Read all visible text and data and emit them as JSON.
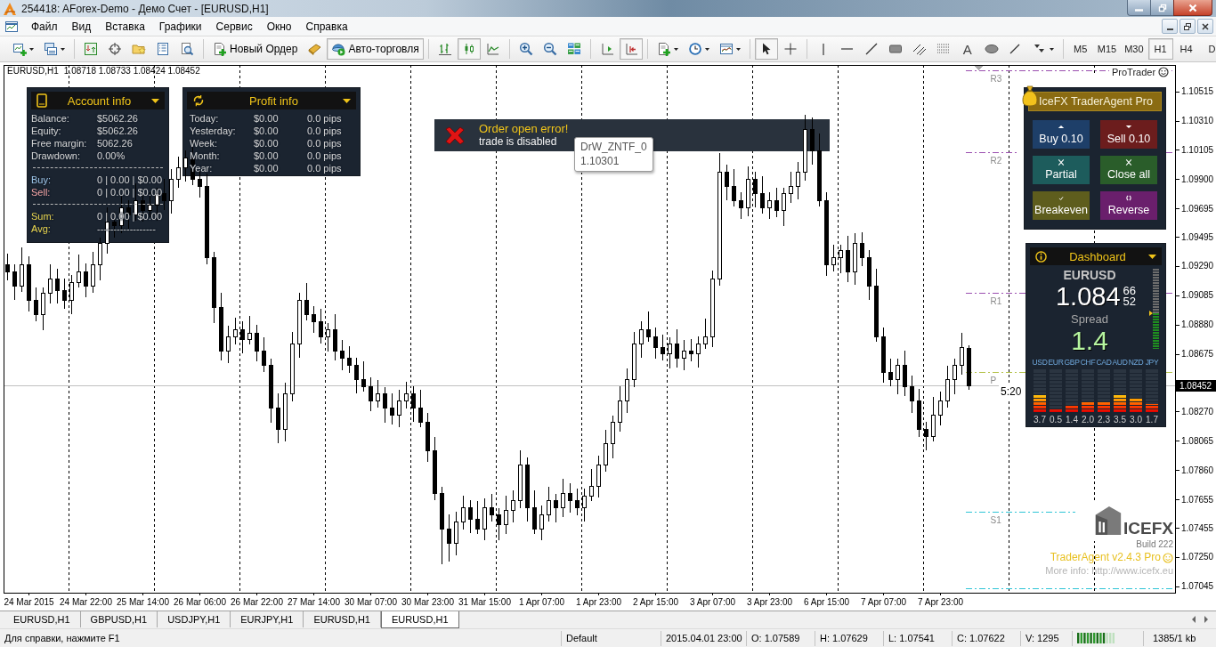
{
  "window": {
    "title": "254418: AForex-Demo - Демо Счет - [EURUSD,H1]"
  },
  "menu": [
    "Файл",
    "Вид",
    "Вставка",
    "Графики",
    "Сервис",
    "Окно",
    "Справка"
  ],
  "toolbar": {
    "groups": [
      [
        {
          "kind": "new-chart",
          "pressed": false
        },
        {
          "kind": "profiles",
          "pressed": false
        }
      ],
      [
        {
          "kind": "market-watch",
          "pressed": false
        },
        {
          "kind": "data-window",
          "pressed": false
        },
        {
          "kind": "navigator",
          "pressed": false
        },
        {
          "kind": "terminal",
          "pressed": false
        },
        {
          "kind": "tester",
          "pressed": false
        }
      ],
      [
        {
          "kind": "new-order",
          "label": "Новый Ордер",
          "pressed": false
        },
        {
          "kind": "editor",
          "pressed": false
        },
        {
          "kind": "autotrade",
          "label": "Авто-торговля",
          "pressed": true
        }
      ],
      [
        {
          "kind": "bar-chart",
          "pressed": false
        },
        {
          "kind": "candles",
          "pressed": true
        },
        {
          "kind": "line-chart",
          "pressed": false
        }
      ],
      [
        {
          "kind": "zoom-in",
          "pressed": false
        },
        {
          "kind": "zoom-out",
          "pressed": false
        },
        {
          "kind": "tile",
          "pressed": false
        }
      ],
      [
        {
          "kind": "chart-shift",
          "pressed": false
        },
        {
          "kind": "autoscroll",
          "pressed": true
        }
      ],
      [
        {
          "kind": "indicators",
          "pressed": false
        },
        {
          "kind": "periods",
          "pressed": false
        },
        {
          "kind": "templates",
          "pressed": false
        }
      ],
      [
        {
          "kind": "cursor",
          "pressed": true
        },
        {
          "kind": "crosshair",
          "pressed": false
        }
      ],
      [
        {
          "kind": "vline",
          "pressed": false
        },
        {
          "kind": "hline",
          "pressed": false
        },
        {
          "kind": "trendline",
          "pressed": false
        },
        {
          "kind": "rectangle",
          "pressed": false
        },
        {
          "kind": "channel",
          "pressed": false
        },
        {
          "kind": "fibo",
          "pressed": false
        },
        {
          "kind": "text",
          "label": "A",
          "pressed": false
        },
        {
          "kind": "ellipse",
          "pressed": false
        },
        {
          "kind": "gann",
          "pressed": false
        },
        {
          "kind": "arrows",
          "pressed": false
        }
      ]
    ],
    "timeframes": [
      {
        "label": "M5",
        "selected": false
      },
      {
        "label": "M15",
        "selected": false
      },
      {
        "label": "M30",
        "selected": false
      },
      {
        "label": "H1",
        "selected": true
      },
      {
        "label": "H4",
        "selected": false
      },
      {
        "label": "D",
        "selected": false
      }
    ]
  },
  "chart": {
    "symbol": "EURUSD,H1",
    "quote": "1.08718 1.08733 1.08424 1.08452",
    "indicator_label": "ProTrader",
    "timer": "5:20",
    "chart_data": {
      "type": "candlestick",
      "categories": [
        null,
        null,
        null,
        "24 Mar 2015",
        null,
        null,
        null,
        null,
        null,
        null,
        null,
        "24 Mar 22:00",
        null,
        null,
        null,
        null,
        null,
        null,
        null,
        "25 Mar 14:00",
        null,
        null,
        null,
        null,
        null,
        null,
        null,
        "26 Mar 06:00",
        null,
        null,
        null,
        null,
        null,
        null,
        null,
        "26 Mar 22:00",
        null,
        null,
        null,
        null,
        null,
        null,
        null,
        "27 Mar 14:00",
        null,
        null,
        null,
        null,
        null,
        null,
        null,
        "30 Mar 07:00",
        null,
        null,
        null,
        null,
        null,
        null,
        null,
        "30 Mar 23:00",
        null,
        null,
        null,
        null,
        null,
        null,
        null,
        "31 Mar 15:00",
        null,
        null,
        null,
        null,
        null,
        null,
        null,
        "1 Apr 07:00",
        null,
        null,
        null,
        null,
        null,
        null,
        null,
        "1 Apr 23:00",
        null,
        null,
        null,
        null,
        null,
        null,
        null,
        "2 Apr 15:00",
        null,
        null,
        null,
        null,
        null,
        null,
        null,
        "3 Apr 07:00",
        null,
        null,
        null,
        null,
        null,
        null,
        null,
        "3 Apr 23:00",
        null,
        null,
        null,
        null,
        null,
        null,
        null,
        "6 Apr 15:00",
        null,
        null,
        null,
        null,
        null,
        null,
        null,
        "7 Apr 07:00",
        null,
        null,
        null,
        null,
        null,
        null,
        null,
        "7 Apr 23:00",
        null,
        null,
        null,
        null,
        null,
        null,
        null,
        null,
        null,
        null,
        null,
        null,
        null,
        null,
        null,
        null,
        null,
        null,
        null,
        null,
        null,
        null,
        null,
        null,
        null,
        null,
        null,
        null,
        null,
        null,
        null,
        null
      ],
      "ohlc": [
        [
          1.093,
          1.0938,
          1.0919,
          1.0925
        ],
        [
          1.0925,
          1.093,
          1.0905,
          1.0915
        ],
        [
          1.0915,
          1.0942,
          1.0911,
          1.093
        ],
        [
          1.093,
          1.0936,
          1.0897,
          1.0905
        ],
        [
          1.0905,
          1.0914,
          1.089,
          1.0895
        ],
        [
          1.0895,
          1.0914,
          1.0884,
          1.091
        ],
        [
          1.091,
          1.093,
          1.0903,
          1.092
        ],
        [
          1.092,
          1.0927,
          1.0903,
          1.0912
        ],
        [
          1.0912,
          1.092,
          1.0899,
          1.0905
        ],
        [
          1.0905,
          1.0923,
          1.0895,
          1.0918
        ],
        [
          1.0918,
          1.0937,
          1.0914,
          1.0925
        ],
        [
          1.0925,
          1.0931,
          1.0907,
          1.0915
        ],
        [
          1.0915,
          1.0939,
          1.091,
          1.093
        ],
        [
          1.093,
          1.0949,
          1.0919,
          1.0945
        ],
        [
          1.0945,
          1.097,
          1.0938,
          1.096
        ],
        [
          1.096,
          1.0967,
          1.0949,
          1.0958
        ],
        [
          1.0958,
          1.0978,
          1.0952,
          1.097
        ],
        [
          1.097,
          1.0975,
          1.0955,
          1.0965
        ],
        [
          1.0965,
          1.0987,
          1.0961,
          1.0975
        ],
        [
          1.0975,
          1.0981,
          1.096,
          1.0968
        ],
        [
          1.0968,
          1.0981,
          1.0963,
          1.0972
        ],
        [
          1.0972,
          1.0984,
          1.0961,
          1.098
        ],
        [
          1.098,
          1.099,
          1.0968,
          1.0975
        ],
        [
          1.0975,
          1.0997,
          1.0966,
          1.099
        ],
        [
          1.099,
          1.1006,
          1.0984,
          1.0998
        ],
        [
          1.0998,
          1.101,
          1.0988,
          1.1005
        ],
        [
          1.1005,
          1.1017,
          1.0986,
          1.099
        ],
        [
          1.099,
          1.0996,
          1.0977,
          1.0985
        ],
        [
          1.0985,
          1.0994,
          1.093,
          1.0935
        ],
        [
          1.0935,
          1.0939,
          1.0889,
          1.09
        ],
        [
          1.09,
          1.091,
          1.0863,
          1.087
        ],
        [
          1.087,
          1.0887,
          1.0861,
          1.088
        ],
        [
          1.088,
          1.0893,
          1.0874,
          1.0885
        ],
        [
          1.0885,
          1.089,
          1.0868,
          1.0878
        ],
        [
          1.0878,
          1.0894,
          1.0874,
          1.0882
        ],
        [
          1.0882,
          1.0888,
          1.0862,
          1.087
        ],
        [
          1.087,
          1.0879,
          1.0855,
          1.086
        ],
        [
          1.086,
          1.0864,
          1.0819,
          1.083
        ],
        [
          1.083,
          1.084,
          1.0805,
          1.0815
        ],
        [
          1.0815,
          1.0847,
          1.0806,
          1.084
        ],
        [
          1.084,
          1.0883,
          1.0834,
          1.0875
        ],
        [
          1.0875,
          1.091,
          1.0865,
          1.0905
        ],
        [
          1.0905,
          1.0917,
          1.0891,
          1.0895
        ],
        [
          1.0895,
          1.0901,
          1.0882,
          1.089
        ],
        [
          1.089,
          1.0899,
          1.0875,
          1.088
        ],
        [
          1.088,
          1.0889,
          1.0869,
          1.0885
        ],
        [
          1.0885,
          1.0895,
          1.0863,
          1.087
        ],
        [
          1.087,
          1.0877,
          1.0856,
          1.0865
        ],
        [
          1.0865,
          1.0873,
          1.0854,
          1.086
        ],
        [
          1.086,
          1.0865,
          1.084,
          1.085
        ],
        [
          1.085,
          1.0862,
          1.0841,
          1.0845
        ],
        [
          1.0845,
          1.0851,
          1.0827,
          1.0835
        ],
        [
          1.0835,
          1.0849,
          1.083,
          1.084
        ],
        [
          1.084,
          1.0844,
          1.0819,
          1.083
        ],
        [
          1.083,
          1.084,
          1.0818,
          1.0825
        ],
        [
          1.0825,
          1.0842,
          1.0816,
          1.0835
        ],
        [
          1.0835,
          1.0848,
          1.0829,
          1.084
        ],
        [
          1.084,
          1.0845,
          1.082,
          1.083
        ],
        [
          1.083,
          1.0842,
          1.0816,
          1.082
        ],
        [
          1.082,
          1.0826,
          1.0792,
          1.08
        ],
        [
          1.08,
          1.0809,
          1.0765,
          1.077
        ],
        [
          1.077,
          1.0774,
          1.072,
          1.0745
        ],
        [
          1.0745,
          1.0755,
          1.0722,
          1.0735
        ],
        [
          1.0735,
          1.0757,
          1.0726,
          1.075
        ],
        [
          1.075,
          1.0768,
          1.0744,
          1.076
        ],
        [
          1.076,
          1.0765,
          1.0742,
          1.0752
        ],
        [
          1.0752,
          1.0764,
          1.0741,
          1.0745
        ],
        [
          1.0745,
          1.0766,
          1.0737,
          1.076
        ],
        [
          1.076,
          1.0769,
          1.075,
          1.0755
        ],
        [
          1.0755,
          1.0759,
          1.0737,
          1.0748
        ],
        [
          1.0748,
          1.0768,
          1.0741,
          1.0758
        ],
        [
          1.0758,
          1.0772,
          1.0749,
          1.0765
        ],
        [
          1.0765,
          1.08,
          1.0759,
          1.079
        ],
        [
          1.079,
          1.0795,
          1.075,
          1.076
        ],
        [
          1.076,
          1.0772,
          1.0741,
          1.0745
        ],
        [
          1.0745,
          1.0761,
          1.0737,
          1.0755
        ],
        [
          1.0755,
          1.0774,
          1.075,
          1.0765
        ],
        [
          1.0765,
          1.0769,
          1.0749,
          1.076
        ],
        [
          1.076,
          1.078,
          1.0753,
          1.077
        ],
        [
          1.077,
          1.0777,
          1.0756,
          1.0765
        ],
        [
          1.0765,
          1.0773,
          1.0754,
          1.076
        ],
        [
          1.076,
          1.0773,
          1.075,
          1.0768
        ],
        [
          1.0768,
          1.0787,
          1.0764,
          1.0775
        ],
        [
          1.0775,
          1.0796,
          1.0767,
          1.079
        ],
        [
          1.079,
          1.0814,
          1.0785,
          1.0805
        ],
        [
          1.0805,
          1.0824,
          1.0794,
          1.082
        ],
        [
          1.082,
          1.0845,
          1.0813,
          1.0835
        ],
        [
          1.0835,
          1.0857,
          1.0826,
          1.085
        ],
        [
          1.085,
          1.0883,
          1.0844,
          1.0875
        ],
        [
          1.0875,
          1.089,
          1.0865,
          1.0885
        ],
        [
          1.0885,
          1.0897,
          1.0876,
          1.088
        ],
        [
          1.088,
          1.0886,
          1.0864,
          1.0872
        ],
        [
          1.0872,
          1.0881,
          1.0863,
          1.0868
        ],
        [
          1.0868,
          1.0879,
          1.0857,
          1.0875
        ],
        [
          1.0875,
          1.0885,
          1.0858,
          1.0865
        ],
        [
          1.0865,
          1.0877,
          1.0856,
          1.087
        ],
        [
          1.087,
          1.0878,
          1.0862,
          1.0868
        ],
        [
          1.0868,
          1.088,
          1.0858,
          1.0875
        ],
        [
          1.0875,
          1.0892,
          1.0871,
          1.088
        ],
        [
          1.088,
          1.0926,
          1.0872,
          1.092
        ],
        [
          1.092,
          1.1008,
          1.0915,
          1.0995
        ],
        [
          1.0995,
          1.1,
          1.0975,
          1.0985
        ],
        [
          1.0985,
          1.0997,
          1.0971,
          1.0975
        ],
        [
          1.0975,
          1.0981,
          1.0962,
          1.097
        ],
        [
          1.097,
          1.0999,
          1.0964,
          1.099
        ],
        [
          1.099,
          1.0995,
          1.097,
          1.098
        ],
        [
          1.098,
          1.0992,
          1.0966,
          1.097
        ],
        [
          1.097,
          1.0981,
          1.0962,
          1.0975
        ],
        [
          1.0975,
          1.0984,
          1.0963,
          1.0968
        ],
        [
          1.0968,
          1.0984,
          1.0957,
          1.098
        ],
        [
          1.098,
          1.0995,
          1.0973,
          1.0985
        ],
        [
          1.0985,
          1.1002,
          1.0976,
          1.0995
        ],
        [
          1.0995,
          1.1035,
          1.0989,
          1.1025
        ],
        [
          1.1025,
          1.1033,
          1.1,
          1.101
        ],
        [
          1.101,
          1.1022,
          1.0971,
          1.0975
        ],
        [
          1.0975,
          1.0981,
          1.0922,
          1.093
        ],
        [
          1.093,
          1.0944,
          1.0925,
          1.0935
        ],
        [
          1.0935,
          1.0944,
          1.0924,
          1.094
        ],
        [
          1.094,
          1.095,
          1.0918,
          1.0925
        ],
        [
          1.0925,
          1.0952,
          1.0916,
          1.0945
        ],
        [
          1.0945,
          1.0953,
          1.0929,
          1.0935
        ],
        [
          1.0935,
          1.094,
          1.0905,
          1.0915
        ],
        [
          1.0915,
          1.0927,
          1.0876,
          1.088
        ],
        [
          1.088,
          1.0886,
          1.0847,
          1.0855
        ],
        [
          1.0855,
          1.0864,
          1.0845,
          1.085
        ],
        [
          1.085,
          1.0864,
          1.0839,
          1.086
        ],
        [
          1.086,
          1.087,
          1.0838,
          1.0845
        ],
        [
          1.0845,
          1.0852,
          1.0826,
          1.0835
        ],
        [
          1.0835,
          1.0843,
          1.0809,
          1.0815
        ],
        [
          1.0815,
          1.082,
          1.08,
          1.081
        ],
        [
          1.081,
          1.0837,
          1.0806,
          1.0825
        ],
        [
          1.0825,
          1.0841,
          1.0817,
          1.0835
        ],
        [
          1.0835,
          1.0859,
          1.083,
          1.085
        ],
        [
          1.085,
          1.0864,
          1.0839,
          1.086
        ],
        [
          1.086,
          1.0882,
          1.0853,
          1.0872
        ],
        [
          1.08718,
          1.08733,
          1.08424,
          1.08452
        ],
        null,
        null,
        null,
        null,
        null,
        null,
        null,
        null,
        null,
        null,
        null,
        null,
        null,
        null,
        null,
        null,
        null,
        null,
        null,
        null,
        null,
        null,
        null,
        null,
        null,
        null,
        null,
        null
      ],
      "ylim": [
        1.07,
        1.107
      ],
      "yticks": [
        {
          "value": 1.10515,
          "label": "1.10515"
        },
        {
          "value": 1.1031,
          "label": "1.10310"
        },
        {
          "value": 1.10105,
          "label": "1.10105"
        },
        {
          "value": 1.099,
          "label": "1.09900"
        },
        {
          "value": 1.09695,
          "label": "1.09695"
        },
        {
          "value": 1.09495,
          "label": "1.09495"
        },
        {
          "value": 1.0929,
          "label": "1.09290"
        },
        {
          "value": 1.09085,
          "label": "1.09085"
        },
        {
          "value": 1.0888,
          "label": "1.08880"
        },
        {
          "value": 1.08675,
          "label": "1.08675"
        },
        {
          "value": 1.0827,
          "label": "1.08270"
        },
        {
          "value": 1.08065,
          "label": "1.08065"
        },
        {
          "value": 1.0786,
          "label": "1.07860"
        },
        {
          "value": 1.07655,
          "label": "1.07655"
        },
        {
          "value": 1.07455,
          "label": "1.07455"
        },
        {
          "value": 1.0725,
          "label": "1.07250"
        },
        {
          "value": 1.07045,
          "label": "1.07045"
        }
      ],
      "ref_lines": [
        {
          "axis": "y",
          "value": 1.1066,
          "label": "R3",
          "color": "#9b4fb0",
          "line_style": "dashdot"
        },
        {
          "axis": "y",
          "value": 1.1009,
          "label": "R2",
          "color": "#9b4fb0",
          "line_style": "dashdot"
        },
        {
          "axis": "y",
          "value": 1.091,
          "label": "R1",
          "color": "#9b4fb0",
          "line_style": "dashdot"
        },
        {
          "axis": "y",
          "value": 1.0855,
          "label": "P",
          "color": "#b5c24a",
          "line_style": "dashdot"
        },
        {
          "axis": "y",
          "value": 1.0757,
          "label": "S1",
          "color": "#2ec4d6",
          "line_style": "dashdot"
        },
        {
          "axis": "y",
          "value": 1.0703,
          "color": "#2ec4d6",
          "line_style": "dashdot"
        },
        {
          "axis": "y",
          "value": 1.08452,
          "label": "1.08452",
          "color": "#c0c0c0",
          "line_style": "solid"
        }
      ],
      "grid": true
    }
  },
  "account_panel": {
    "title": "Account info",
    "sections": [
      [
        {
          "label": "Balance:",
          "value": "$5062.26",
          "color": "#d4d4d4"
        },
        {
          "label": "Equity:",
          "value": "$5062.26",
          "color": "#d4d4d4"
        },
        {
          "label": "Free margin:",
          "value": "5062.26",
          "color": "#d4d4d4"
        },
        {
          "label": "Drawdown:",
          "value": "0.00%",
          "color": "#d4d4d4"
        }
      ],
      [
        {
          "label": "Buy:",
          "value": "0 | 0.00 | $0.00",
          "color": "#9cc3e6"
        },
        {
          "label": "Sell:",
          "value": "0 | 0.00 | $0.00",
          "color": "#f2a3a3"
        }
      ],
      [
        {
          "label": "Sum:",
          "value": "0 | 0.00 | $0.00",
          "color": "#e8d44d"
        },
        {
          "label": "Avg:",
          "value": "------------------",
          "color": "#e8d44d"
        }
      ]
    ]
  },
  "profit_panel": {
    "title": "Profit info",
    "rows": [
      {
        "label": "Today:",
        "amount": "$0.00",
        "pips": "0.0 pips"
      },
      {
        "label": "Yesterday:",
        "amount": "$0.00",
        "pips": "0.0 pips"
      },
      {
        "label": "Week:",
        "amount": "$0.00",
        "pips": "0.0 pips"
      },
      {
        "label": "Month:",
        "amount": "$0.00",
        "pips": "0.0 pips"
      },
      {
        "label": "Year:",
        "amount": "$0.00",
        "pips": "0.0 pips"
      }
    ]
  },
  "alert": {
    "title": "Order open error!",
    "message": "trade is disabled"
  },
  "tooltip": {
    "title": "DrW_ZNTF_0",
    "value": "1.10301"
  },
  "trader_agent": {
    "title": "IceFX TraderAgent Pro",
    "buttons": [
      {
        "kind": "buy",
        "label": "Buy 0.10",
        "color": "#1e3f69"
      },
      {
        "kind": "sell",
        "label": "Sell 0.10",
        "color": "#6c1d1d"
      },
      {
        "kind": "partial",
        "label": "Partial",
        "color": "#1d5c5c"
      },
      {
        "kind": "close",
        "label": "Close all",
        "color": "#2a5d2a"
      },
      {
        "kind": "breakeven",
        "label": "Breakeven",
        "color": "#5e5d1d"
      },
      {
        "kind": "reverse",
        "label": "Reverse",
        "color": "#6a1f6c"
      }
    ]
  },
  "dashboard": {
    "title": "Dashboard",
    "symbol": "EURUSD",
    "price": "1.084",
    "price_ask": "66",
    "price_bid": "52",
    "meter": {
      "level": 0.45
    },
    "spread_label": "Spread",
    "spread": "1.4",
    "chart_data": {
      "type": "bar",
      "categories": [
        "USD",
        "EUR",
        "GBP",
        "CHF",
        "CAD",
        "AUD",
        "NZD",
        "JPY"
      ],
      "values": [
        3.7,
        0.5,
        1.4,
        2.0,
        2.3,
        3.5,
        3.0,
        1.7
      ],
      "value_labels": [
        "3.7",
        "0.5",
        "1.4",
        "2.0",
        "2.3",
        "3.5",
        "3.0",
        "1.7"
      ]
    }
  },
  "branding": {
    "logo_text": "ICEFX",
    "build": "Build 222",
    "product": "TraderAgent v2.4.3 Pro",
    "info": "More info: http://www.icefx.eu"
  },
  "tabs": [
    {
      "label": "EURUSD,H1",
      "selected": false
    },
    {
      "label": "GBPUSD,H1",
      "selected": false
    },
    {
      "label": "USDJPY,H1",
      "selected": false
    },
    {
      "label": "EURJPY,H1",
      "selected": false
    },
    {
      "label": "EURUSD,H1",
      "selected": false
    },
    {
      "label": "EURUSD,H1",
      "selected": true
    }
  ],
  "status_bar": {
    "help": "Для справки, нажмите F1",
    "profile": "Default",
    "time": "2015.04.01 23:00",
    "values": [
      "O: 1.07589",
      "H: 1.07629",
      "L: 1.07541",
      "C: 1.07622",
      "V: 1295"
    ],
    "traffic": "1385/1 kb"
  }
}
